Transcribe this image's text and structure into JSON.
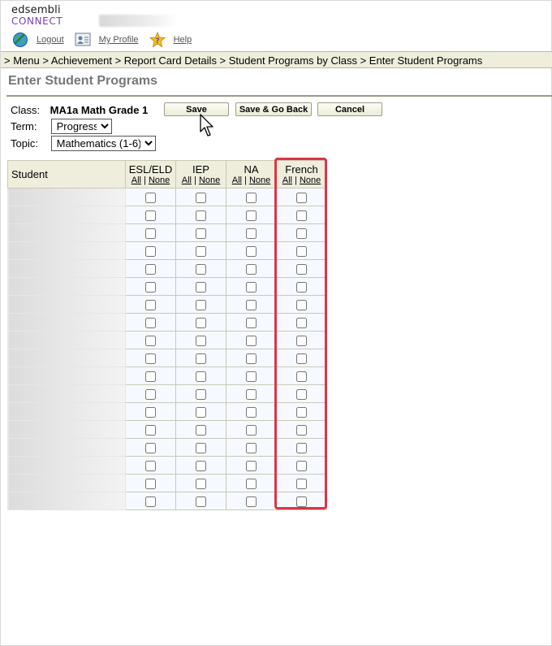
{
  "logo": {
    "line1": "edsembli",
    "line2": "CONNECT"
  },
  "topnav": {
    "logout": "Logout",
    "profile": "My Profile",
    "help": "Help"
  },
  "breadcrumb": "> Menu > Achievement > Report Card Details > Student Programs by Class > Enter Student Programs",
  "page_title": "Enter Student Programs",
  "form": {
    "class_label": "Class:",
    "class_value": "MA1a Math Grade 1",
    "term_label": "Term:",
    "term_value": "Progress",
    "topic_label": "Topic:",
    "topic_value": "Mathematics (1-6)"
  },
  "buttons": {
    "save": "Save",
    "save_go_back": "Save & Go Back",
    "cancel": "Cancel"
  },
  "grid": {
    "student_header": "Student",
    "all": "All",
    "sep": "|",
    "none": "None",
    "programs": [
      "ESL/ELD",
      "IEP",
      "NA",
      "French"
    ],
    "row_count": 18
  },
  "colors": {
    "header_bg": "#efeedd",
    "highlight": "#dc3545",
    "logo_accent": "#7a3fb0"
  }
}
